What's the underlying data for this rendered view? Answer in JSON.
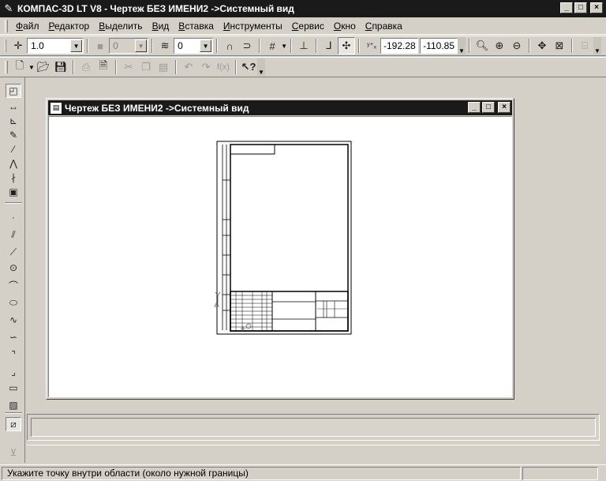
{
  "window": {
    "title": "КОМПАС-3D LT V8 - Чертеж БЕЗ ИМЕНИ2 ->Системный вид",
    "min": "_",
    "max": "□",
    "close": "×"
  },
  "menu": [
    "Файл",
    "Редактор",
    "Выделить",
    "Вид",
    "Вставка",
    "Инструменты",
    "Сервис",
    "Окно",
    "Справка"
  ],
  "toolbar_current": {
    "line_style": "1.0",
    "color_value": "0",
    "layer": "0",
    "coord_x": "-192.28",
    "coord_y": "-110.85"
  },
  "document": {
    "title": "Чертеж БЕЗ ИМЕНИ2 ->Системный вид",
    "min": "_",
    "max": "□",
    "close": "×"
  },
  "status": {
    "message": "Укажите точку внутри области (около нужной границы)"
  },
  "icons": {
    "app": "kompas-logo-icon",
    "snap": "crosshair-icon",
    "new": "new-document-icon",
    "open": "open-folder-icon",
    "save": "save-icon",
    "print": "print-icon",
    "preview": "print-preview-icon",
    "cut": "scissors-icon",
    "copy": "copy-icon",
    "paste": "paste-icon",
    "undo": "undo-icon",
    "redo": "redo-icon",
    "fx": "function-icon",
    "help": "help-pointer-icon",
    "zoom": "magnifier-icon",
    "pan": "pan-icon"
  },
  "colors": {
    "titlebar": "#1a1a1a",
    "face": "#d4d0c8",
    "canvas": "#ffffff"
  }
}
